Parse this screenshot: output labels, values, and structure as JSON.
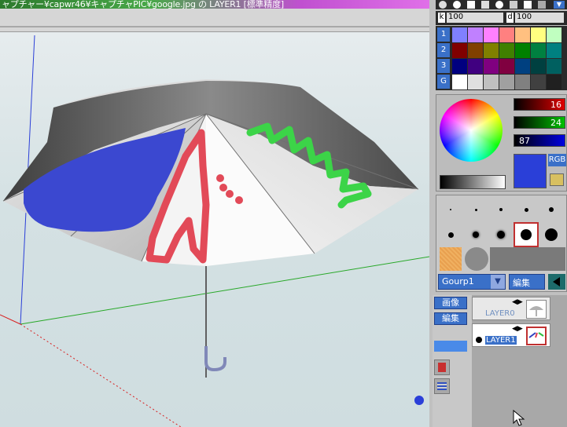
{
  "window": {
    "title": "ャプチャー¥capwr46¥キャプチャPIC¥google.jpg の LAYER1 [標準精度]"
  },
  "colors": {
    "umbrella_blue": "#3b48d0",
    "umbrella_red": "#e24a58",
    "umbrella_green": "#3cd448",
    "current_color": "#2a3fd8",
    "panel_bg": "#c0c0c0"
  },
  "tool_panel": {
    "opacity_label": "k",
    "opacity_value": "100",
    "density_label": "d",
    "density_value": "100"
  },
  "palette": {
    "row_labels": [
      "1",
      "2",
      "3",
      "G"
    ],
    "rows": [
      [
        "#8080ff",
        "#c080ff",
        "#ff80ff",
        "#ff8080",
        "#ffc080",
        "#ffff80",
        "#c0ffc0"
      ],
      [
        "#800000",
        "#804000",
        "#808000",
        "#408000",
        "#008000",
        "#008040",
        "#008080"
      ],
      [
        "#000080",
        "#400080",
        "#800080",
        "#800040",
        "#004080",
        "#004040",
        "#006060"
      ],
      [
        "#ffffff",
        "#e0e0e0",
        "#c0c0c0",
        "#a0a0a0",
        "#808080",
        "#404040",
        "#202020"
      ]
    ]
  },
  "color_values": {
    "r": "16",
    "g": "24",
    "b": "87",
    "mode_button": "RGB"
  },
  "brushes": {
    "group_select": "Gourp1",
    "edit_button": "編集"
  },
  "layers_panel": {
    "image_button": "画像",
    "edit_button": "編集",
    "layers": [
      {
        "name": "LAYER0",
        "active": false
      },
      {
        "name": "LAYER1",
        "active": true
      }
    ]
  }
}
